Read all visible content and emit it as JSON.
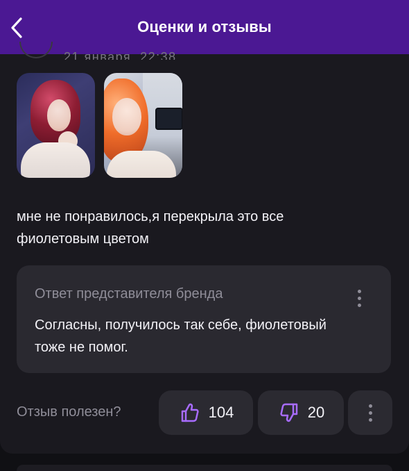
{
  "header": {
    "title": "Оценки и отзывы"
  },
  "review": {
    "date": "21 января, 22:38",
    "text": "мне не понравилось,я перекрыла это все фиолетовым цветом"
  },
  "brand_reply": {
    "title": "Ответ представителя бренда",
    "text": "Согласны, получилось так себе, фиолетовый тоже не помог."
  },
  "helpful": {
    "label": "Отзыв полезен?",
    "likes": "104",
    "dislikes": "20"
  },
  "icons": {
    "back": "chevron-left-icon",
    "like": "thumbs-up-icon",
    "dislike": "thumbs-down-icon",
    "more": "more-vertical-icon"
  },
  "colors": {
    "header": "#4b1893",
    "accent": "#a86cff"
  }
}
